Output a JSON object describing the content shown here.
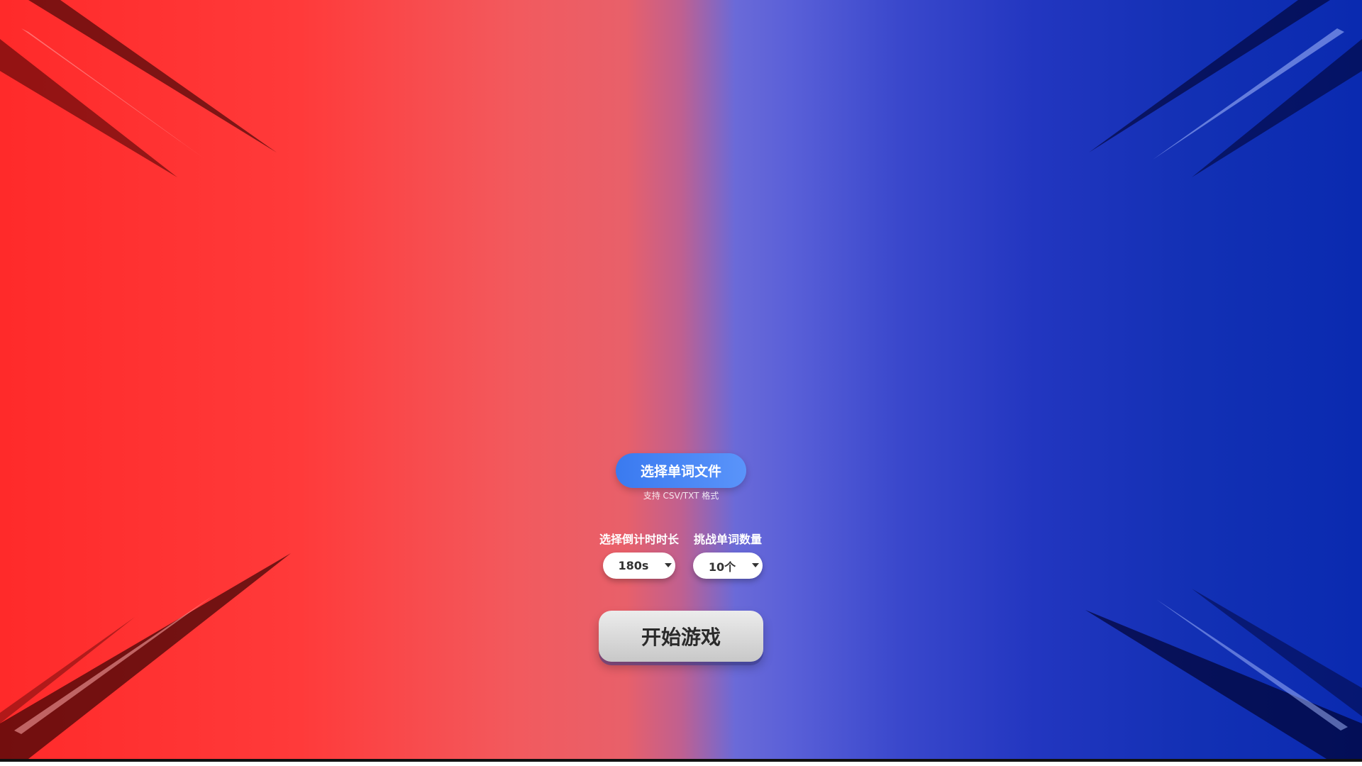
{
  "upload": {
    "button_label": "选择单词文件",
    "hint": "支持 CSV/TXT 格式"
  },
  "settings": {
    "duration": {
      "label": "选择倒计时时长",
      "selected": "180s"
    },
    "word_count": {
      "label": "挑战单词数量",
      "selected": "10个"
    }
  },
  "start": {
    "button_label": "开始游戏"
  },
  "colors": {
    "left_background": "#ff2a2a",
    "right_background": "#0a2ab0",
    "upload_button": "#4a88f6",
    "start_button": "#d8d8d8"
  }
}
